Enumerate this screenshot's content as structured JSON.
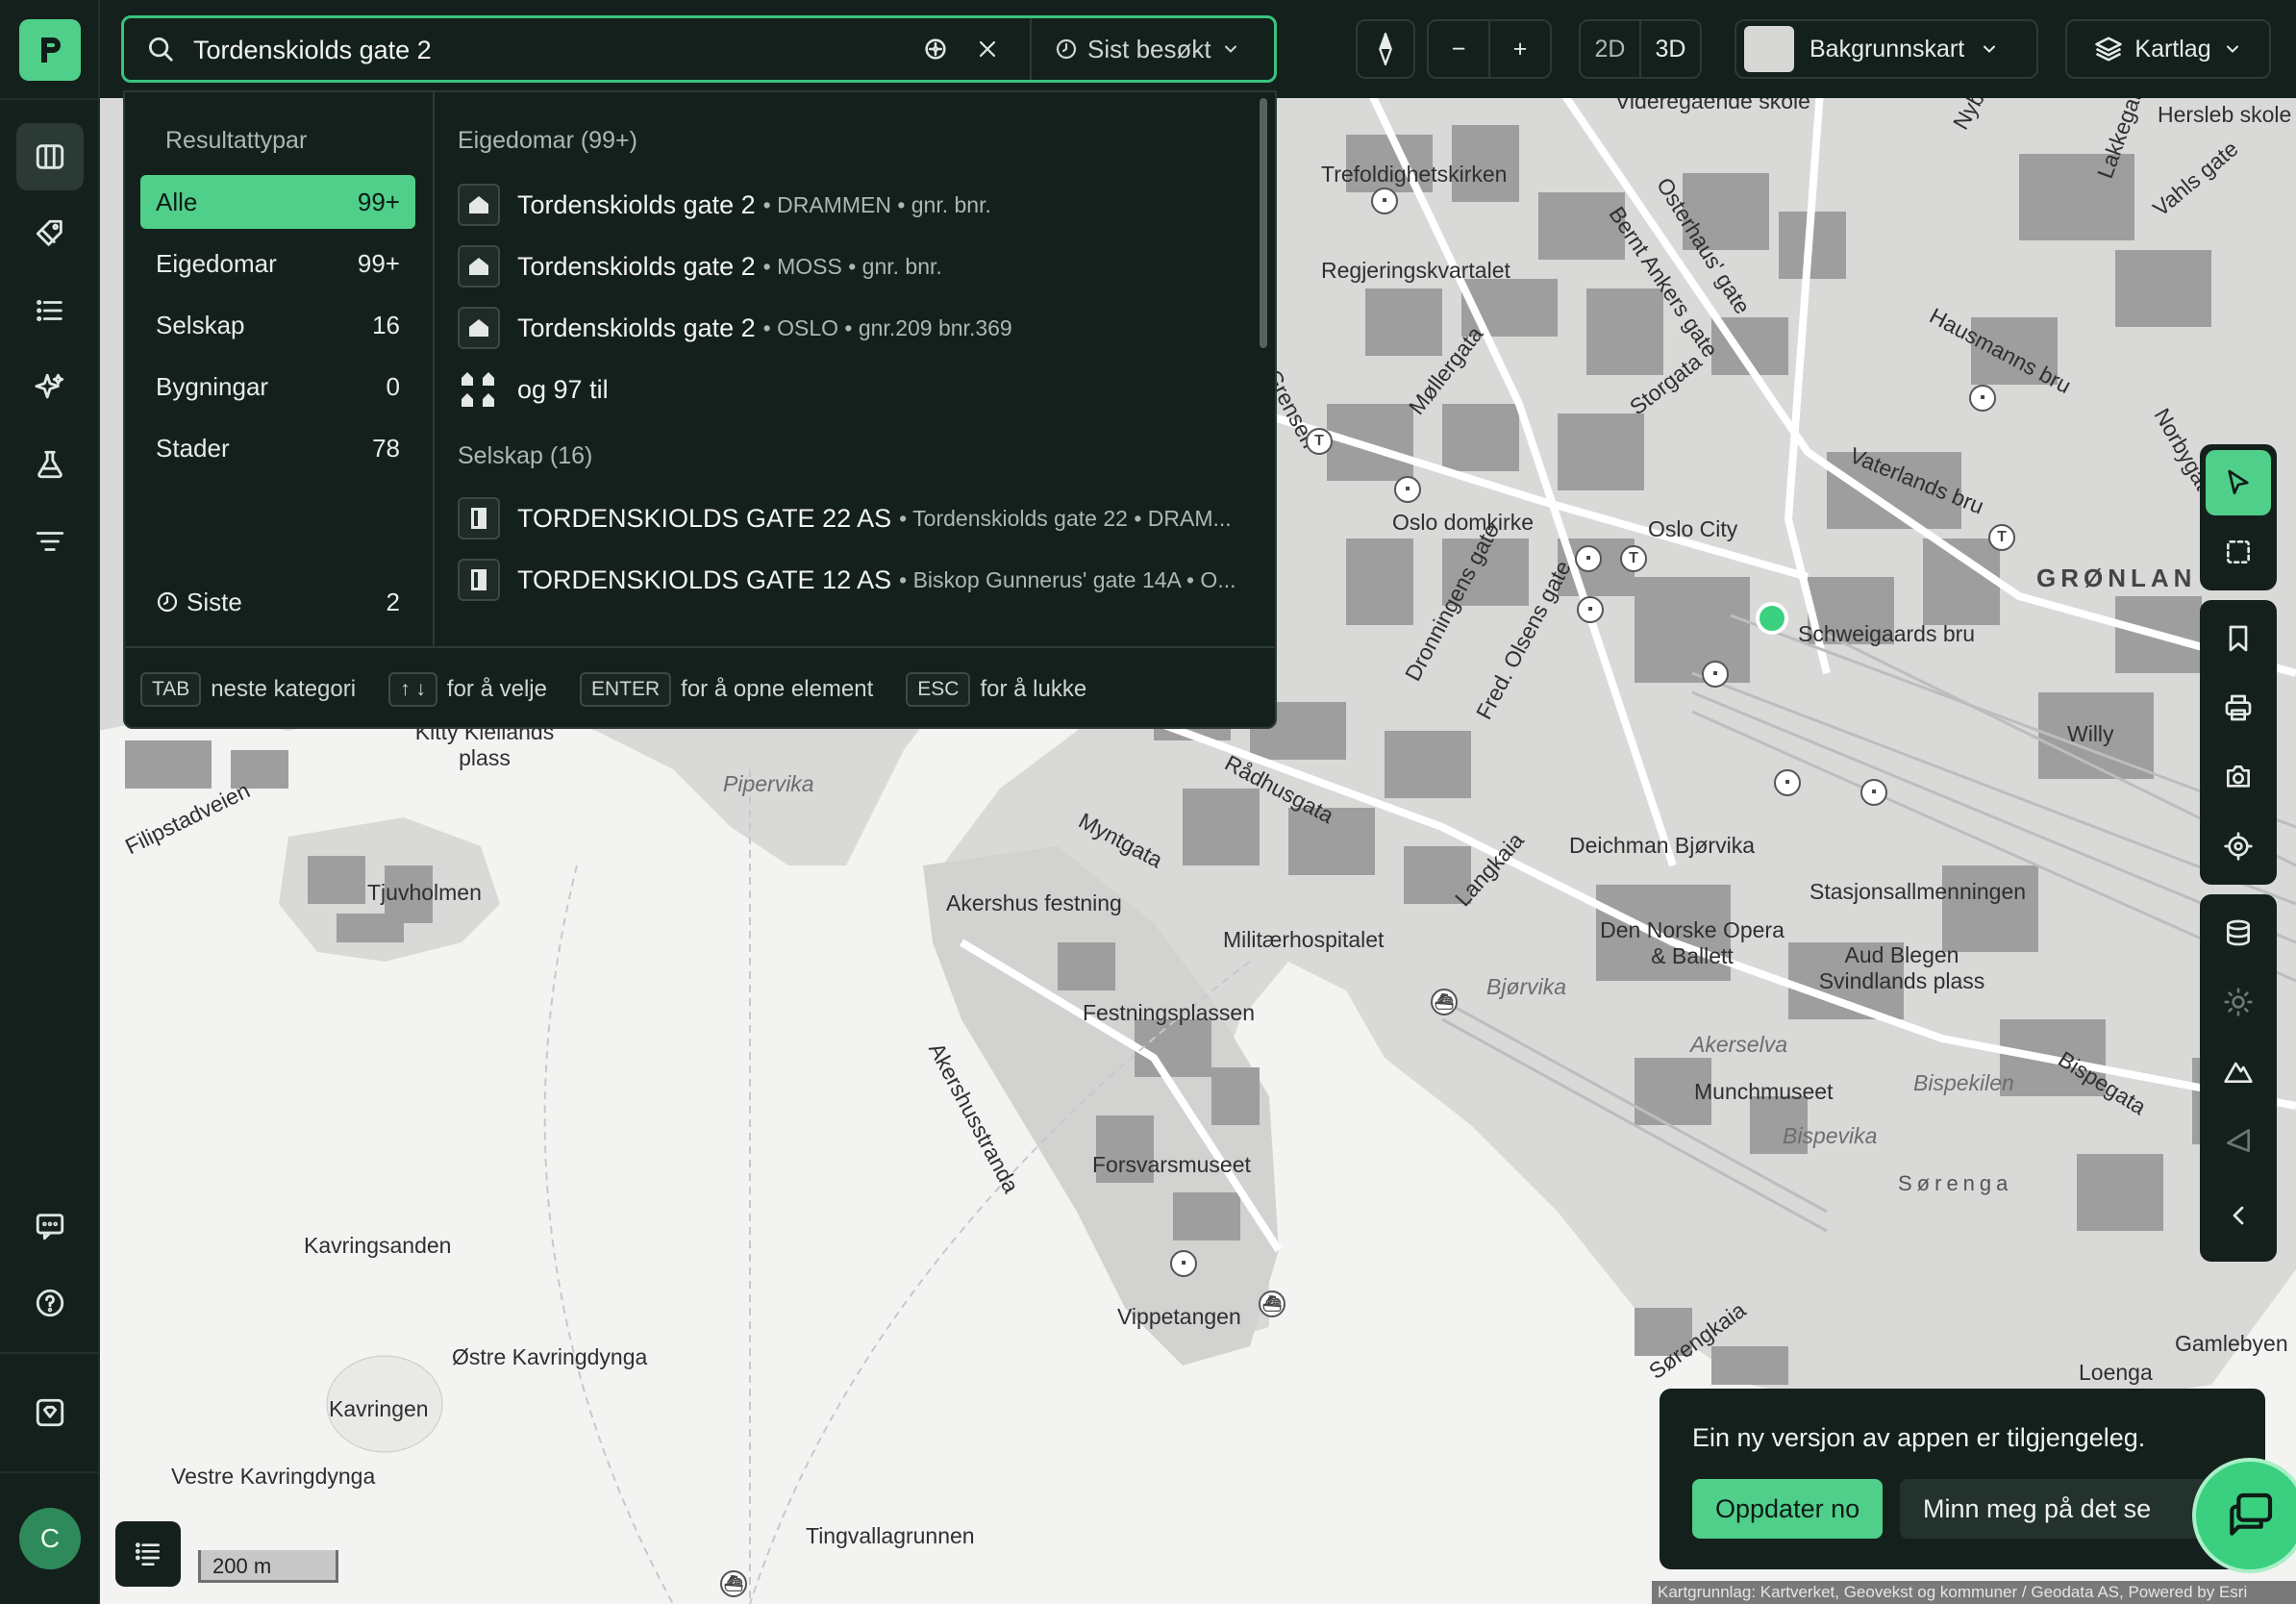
{
  "search": {
    "value": "Tordenskiolds gate 2",
    "recent_label": "Sist besøkt"
  },
  "toolbar": {
    "zoom_out": "−",
    "zoom_in": "+",
    "mode_2d": "2D",
    "mode_3d": "3D",
    "basemap_label": "Bakgrunnskart",
    "layers_label": "Kartlag"
  },
  "dropdown": {
    "categories_heading": "Resultattypar",
    "categories": [
      {
        "label": "Alle",
        "count": "99+"
      },
      {
        "label": "Eigedomar",
        "count": "99+"
      },
      {
        "label": "Selskap",
        "count": "16"
      },
      {
        "label": "Bygningar",
        "count": "0"
      },
      {
        "label": "Stader",
        "count": "78"
      }
    ],
    "recent": {
      "label": "Siste",
      "count": "2"
    },
    "groups": [
      {
        "heading": "Eigedomar (99+)",
        "rows": [
          {
            "title": "Tordenskiolds gate 2",
            "meta": "• DRAMMEN • gnr. bnr."
          },
          {
            "title": "Tordenskiolds gate 2",
            "meta": "• MOSS • gnr. bnr."
          },
          {
            "title": "Tordenskiolds gate 2",
            "meta": "• OSLO • gnr.209 bnr.369"
          }
        ],
        "more": "og 97 til"
      },
      {
        "heading": "Selskap (16)",
        "rows": [
          {
            "title": "TORDENSKIOLDS GATE 22 AS",
            "meta": "• Tordenskiolds gate 22 • DRAM..."
          },
          {
            "title": "TORDENSKIOLDS GATE 12 AS",
            "meta": "• Biskop Gunnerus' gate 14A • O..."
          }
        ]
      }
    ],
    "footer": [
      {
        "key": "TAB",
        "text": "neste kategori"
      },
      {
        "key": "↑ ↓",
        "text": "for å velje"
      },
      {
        "key": "ENTER",
        "text": "for å opne element"
      },
      {
        "key": "ESC",
        "text": "for å lukke"
      }
    ]
  },
  "sidebar": {
    "avatar_initial": "C"
  },
  "toast": {
    "message": "Ein ny versjon av appen er tilgjengeleg.",
    "update_label": "Oppdater no",
    "remind_label": "Minn meg på det se"
  },
  "map": {
    "scale_label": "200 m",
    "attribution": "Kartgrunnlag: Kartverket, Geovekst og kommuner / Geodata AS, Powered by Esri",
    "labels": [
      {
        "text": "Trefoldighetskirken",
        "cls": ""
      },
      {
        "text": "Regjeringskvartalet",
        "cls": ""
      },
      {
        "text": "Oslo domkirke",
        "cls": ""
      },
      {
        "text": "Oslo City",
        "cls": ""
      },
      {
        "text": "Schweigaards bru",
        "cls": ""
      },
      {
        "text": "GRØNLAN",
        "cls": "district"
      },
      {
        "text": "Storgata",
        "cls": ""
      },
      {
        "text": "Møllergata",
        "cls": ""
      },
      {
        "text": "Grensen",
        "cls": ""
      },
      {
        "text": "Hausmanns bru",
        "cls": ""
      },
      {
        "text": "Vaterlands bru",
        "cls": ""
      },
      {
        "text": "Vahls gate",
        "cls": ""
      },
      {
        "text": "Lakkegata",
        "cls": ""
      },
      {
        "text": "Norbygata",
        "cls": ""
      },
      {
        "text": "Nybrua",
        "cls": ""
      },
      {
        "text": "Hersleb skole",
        "cls": ""
      },
      {
        "text": "Osterhaus' gate",
        "cls": ""
      },
      {
        "text": "Bernt Ankers gate",
        "cls": ""
      },
      {
        "text": "Dronningens gate",
        "cls": ""
      },
      {
        "text": "Fred. Olsens gate",
        "cls": ""
      },
      {
        "text": "Rådhusgata",
        "cls": ""
      },
      {
        "text": "Myntgata",
        "cls": ""
      },
      {
        "text": "Kitty Kiellands plass",
        "cls": ""
      },
      {
        "text": "Pipervika",
        "cls": "water"
      },
      {
        "text": "Filipstadveien",
        "cls": ""
      },
      {
        "text": "Tjuvholmen",
        "cls": ""
      },
      {
        "text": "Akershus festning",
        "cls": ""
      },
      {
        "text": "Militærhospitalet",
        "cls": ""
      },
      {
        "text": "Langkaia",
        "cls": ""
      },
      {
        "text": "Bjørvika",
        "cls": "water"
      },
      {
        "text": "Deichman Bjørvika",
        "cls": ""
      },
      {
        "text": "Stasjonsallmenningen",
        "cls": ""
      },
      {
        "text": "Den Norske Opera & Ballett",
        "cls": ""
      },
      {
        "text": "Aud Blegen Svindlands plass",
        "cls": ""
      },
      {
        "text": "Festningsplassen",
        "cls": ""
      },
      {
        "text": "Akerselva",
        "cls": "water"
      },
      {
        "text": "Munchmuseet",
        "cls": ""
      },
      {
        "text": "Bispekilen",
        "cls": "water"
      },
      {
        "text": "Bispevika",
        "cls": "water"
      },
      {
        "text": "Bispegata",
        "cls": ""
      },
      {
        "text": "Sørenga",
        "cls": "districtlight"
      },
      {
        "text": "Akershusstranda",
        "cls": ""
      },
      {
        "text": "Forsvarsmuseet",
        "cls": ""
      },
      {
        "text": "Vippetangen",
        "cls": ""
      },
      {
        "text": "Kavringsanden",
        "cls": ""
      },
      {
        "text": "Østre Kavringdynga",
        "cls": ""
      },
      {
        "text": "Kavringen",
        "cls": ""
      },
      {
        "text": "Vestre Kavringdynga",
        "cls": ""
      },
      {
        "text": "Tingvallagrunnen",
        "cls": ""
      },
      {
        "text": "Sørengkaia",
        "cls": ""
      },
      {
        "text": "Gamlebyen",
        "cls": ""
      },
      {
        "text": "Loenga",
        "cls": ""
      },
      {
        "text": "Willy",
        "cls": ""
      },
      {
        "text": "Videregående skole",
        "cls": ""
      }
    ]
  },
  "colors": {
    "accent": "#4fcf8a",
    "panel": "#14201c",
    "map_background": "#e4e4e2",
    "location_dot": "#3ad080"
  }
}
